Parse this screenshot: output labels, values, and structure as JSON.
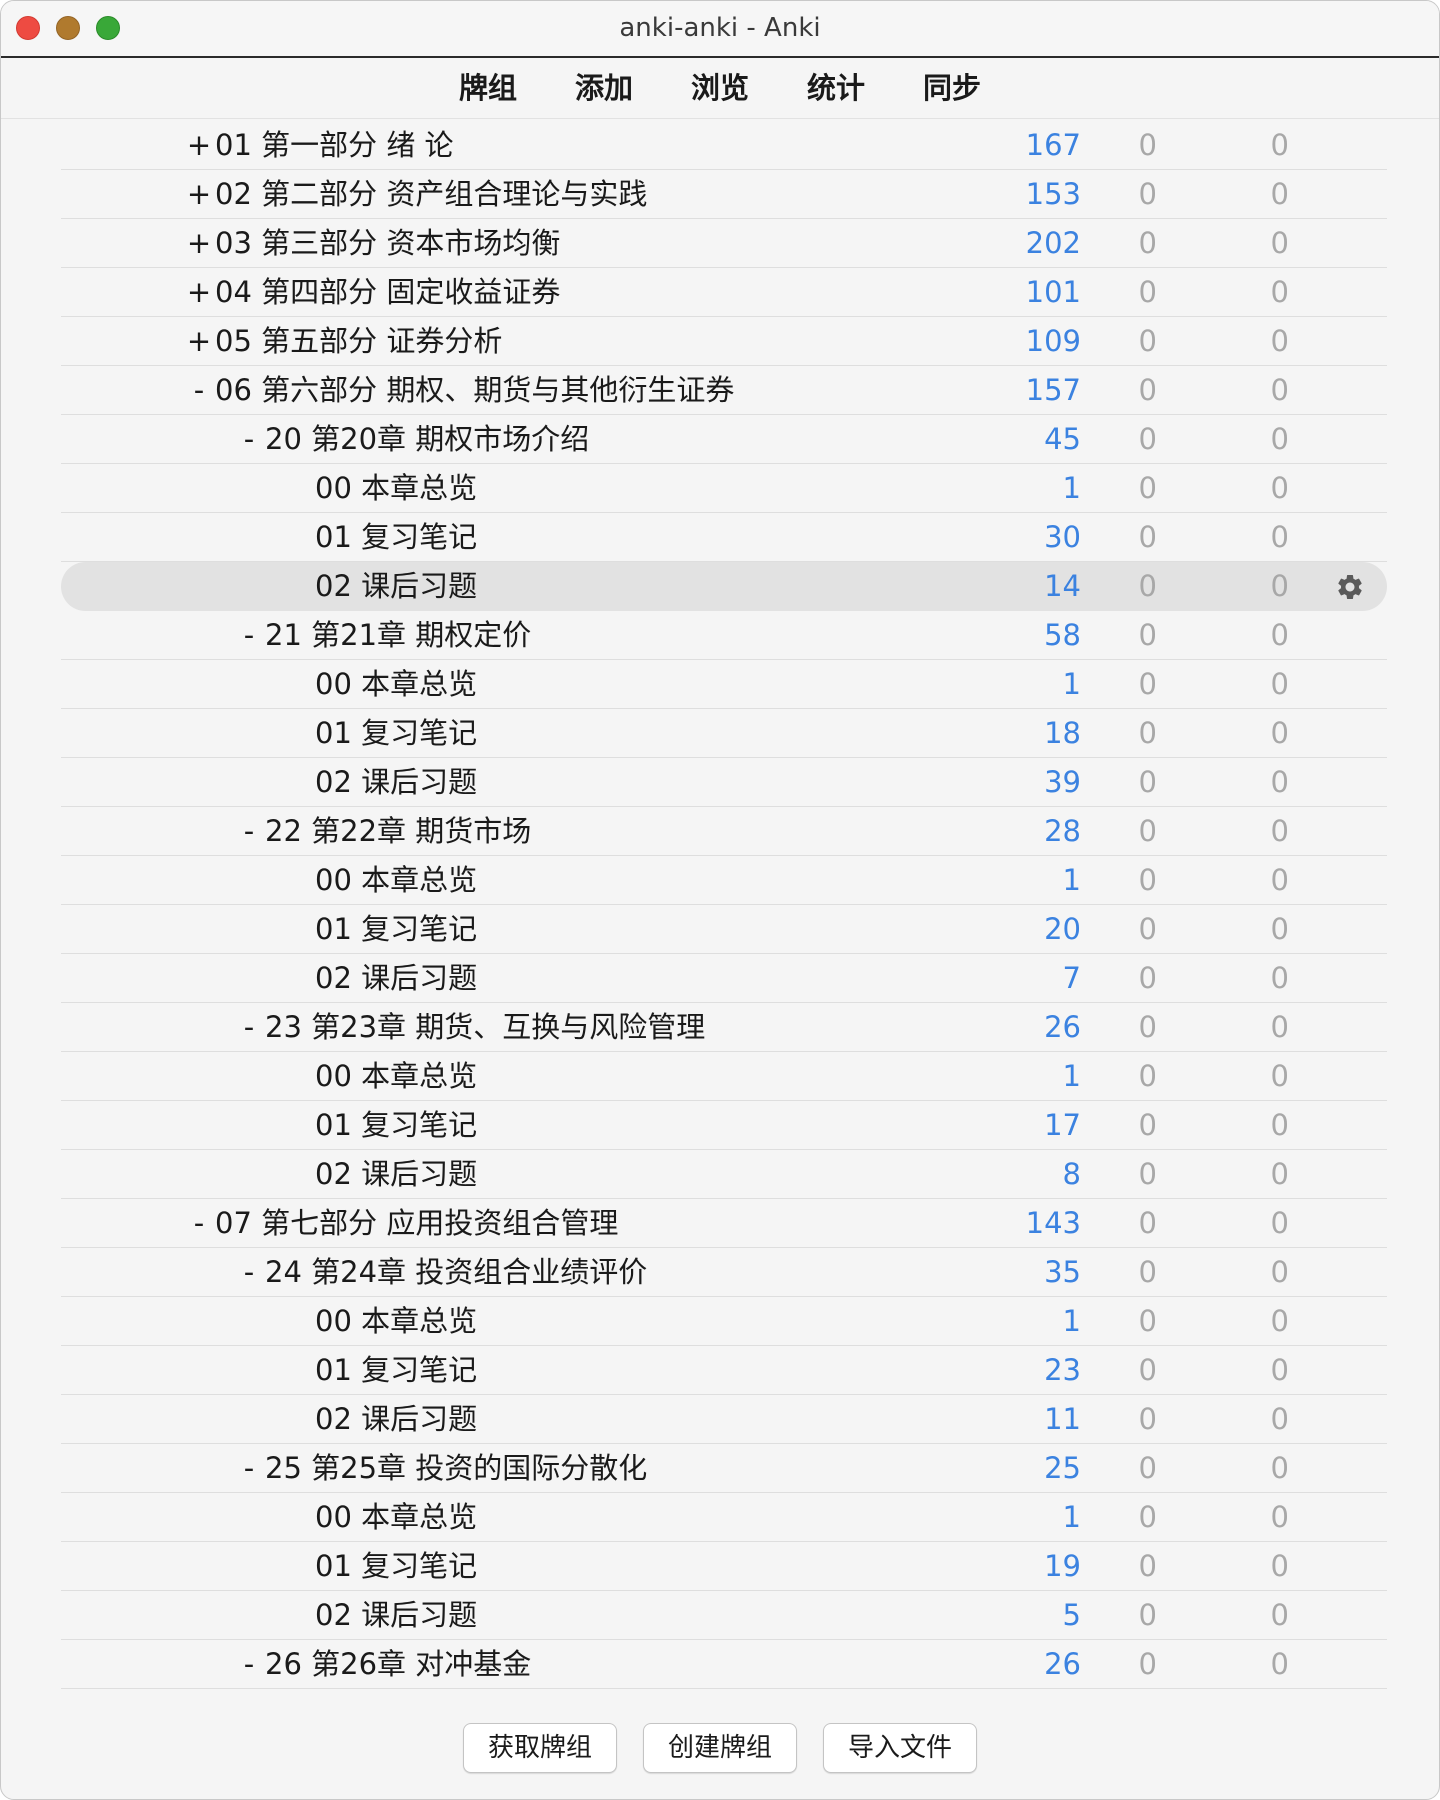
{
  "window": {
    "title": "anki-anki - Anki"
  },
  "toolbar": {
    "items": [
      "牌组",
      "添加",
      "浏览",
      "统计",
      "同步"
    ]
  },
  "decks": [
    {
      "toggle": "+",
      "name": "01 第一部分 绪 论",
      "depth": 0,
      "new": "167",
      "learn": "0",
      "due": "0"
    },
    {
      "toggle": "+",
      "name": "02 第二部分 资产组合理论与实践",
      "depth": 0,
      "new": "153",
      "learn": "0",
      "due": "0"
    },
    {
      "toggle": "+",
      "name": "03 第三部分 资本市场均衡",
      "depth": 0,
      "new": "202",
      "learn": "0",
      "due": "0"
    },
    {
      "toggle": "+",
      "name": "04 第四部分 固定收益证券",
      "depth": 0,
      "new": "101",
      "learn": "0",
      "due": "0"
    },
    {
      "toggle": "+",
      "name": "05 第五部分 证券分析",
      "depth": 0,
      "new": "109",
      "learn": "0",
      "due": "0"
    },
    {
      "toggle": "-",
      "name": "06 第六部分 期权、期货与其他衍生证券",
      "depth": 0,
      "new": "157",
      "learn": "0",
      "due": "0"
    },
    {
      "toggle": "-",
      "name": "20 第20章 期权市场介绍",
      "depth": 1,
      "new": "45",
      "learn": "0",
      "due": "0"
    },
    {
      "toggle": "",
      "name": "00 本章总览",
      "depth": 2,
      "new": "1",
      "learn": "0",
      "due": "0"
    },
    {
      "toggle": "",
      "name": "01 复习笔记",
      "depth": 2,
      "new": "30",
      "learn": "0",
      "due": "0"
    },
    {
      "toggle": "",
      "name": "02 课后习题",
      "depth": 2,
      "new": "14",
      "learn": "0",
      "due": "0",
      "selected": true
    },
    {
      "toggle": "-",
      "name": "21 第21章 期权定价",
      "depth": 1,
      "new": "58",
      "learn": "0",
      "due": "0"
    },
    {
      "toggle": "",
      "name": "00 本章总览",
      "depth": 2,
      "new": "1",
      "learn": "0",
      "due": "0"
    },
    {
      "toggle": "",
      "name": "01 复习笔记",
      "depth": 2,
      "new": "18",
      "learn": "0",
      "due": "0"
    },
    {
      "toggle": "",
      "name": "02 课后习题",
      "depth": 2,
      "new": "39",
      "learn": "0",
      "due": "0"
    },
    {
      "toggle": "-",
      "name": "22 第22章 期货市场",
      "depth": 1,
      "new": "28",
      "learn": "0",
      "due": "0"
    },
    {
      "toggle": "",
      "name": "00 本章总览",
      "depth": 2,
      "new": "1",
      "learn": "0",
      "due": "0"
    },
    {
      "toggle": "",
      "name": "01 复习笔记",
      "depth": 2,
      "new": "20",
      "learn": "0",
      "due": "0"
    },
    {
      "toggle": "",
      "name": "02 课后习题",
      "depth": 2,
      "new": "7",
      "learn": "0",
      "due": "0"
    },
    {
      "toggle": "-",
      "name": "23 第23章 期货、互换与风险管理",
      "depth": 1,
      "new": "26",
      "learn": "0",
      "due": "0"
    },
    {
      "toggle": "",
      "name": "00 本章总览",
      "depth": 2,
      "new": "1",
      "learn": "0",
      "due": "0"
    },
    {
      "toggle": "",
      "name": "01 复习笔记",
      "depth": 2,
      "new": "17",
      "learn": "0",
      "due": "0"
    },
    {
      "toggle": "",
      "name": "02 课后习题",
      "depth": 2,
      "new": "8",
      "learn": "0",
      "due": "0"
    },
    {
      "toggle": "-",
      "name": "07 第七部分 应用投资组合管理",
      "depth": 0,
      "new": "143",
      "learn": "0",
      "due": "0"
    },
    {
      "toggle": "-",
      "name": "24 第24章 投资组合业绩评价",
      "depth": 1,
      "new": "35",
      "learn": "0",
      "due": "0"
    },
    {
      "toggle": "",
      "name": "00 本章总览",
      "depth": 2,
      "new": "1",
      "learn": "0",
      "due": "0"
    },
    {
      "toggle": "",
      "name": "01 复习笔记",
      "depth": 2,
      "new": "23",
      "learn": "0",
      "due": "0"
    },
    {
      "toggle": "",
      "name": "02 课后习题",
      "depth": 2,
      "new": "11",
      "learn": "0",
      "due": "0"
    },
    {
      "toggle": "-",
      "name": "25 第25章 投资的国际分散化",
      "depth": 1,
      "new": "25",
      "learn": "0",
      "due": "0"
    },
    {
      "toggle": "",
      "name": "00 本章总览",
      "depth": 2,
      "new": "1",
      "learn": "0",
      "due": "0"
    },
    {
      "toggle": "",
      "name": "01 复习笔记",
      "depth": 2,
      "new": "19",
      "learn": "0",
      "due": "0"
    },
    {
      "toggle": "",
      "name": "02 课后习题",
      "depth": 2,
      "new": "5",
      "learn": "0",
      "due": "0"
    },
    {
      "toggle": "-",
      "name": "26 第26章 对冲基金",
      "depth": 1,
      "new": "26",
      "learn": "0",
      "due": "0"
    }
  ],
  "selected_row_icon": "gear-icon",
  "bottom_buttons": {
    "get_shared": "获取牌组",
    "create_deck": "创建牌组",
    "import_file": "导入文件"
  },
  "colors": {
    "new_count": "#3b82e0",
    "zero_count": "#a8a8a8",
    "selected_row": "#e2e2e2"
  }
}
